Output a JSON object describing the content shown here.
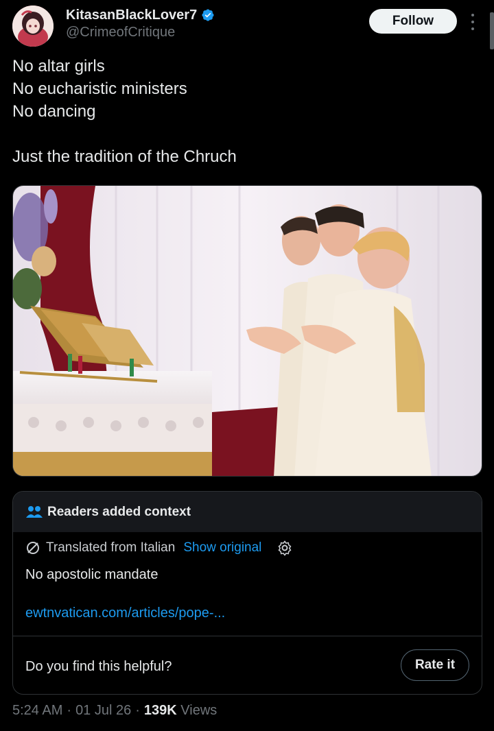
{
  "author": {
    "display_name": "KitasanBlackLover7",
    "handle": "@CrimeofCritique",
    "verified": true
  },
  "actions": {
    "follow_label": "Follow",
    "more_icon": "more-vertical-icon"
  },
  "tweet": {
    "lines": [
      "No altar girls",
      "No eucharistic ministers",
      "No dancing",
      "",
      "Just the tradition of the Chruch"
    ]
  },
  "community_note": {
    "title": "Readers added context",
    "translated_label": "Translated from Italian",
    "show_original_label": "Show original",
    "body": "No apostolic mandate",
    "link": "ewtnvatican.com/articles/pope-...",
    "helpful_question": "Do you find this helpful?",
    "rate_label": "Rate it"
  },
  "meta": {
    "time": "5:24 AM",
    "date": "01 Jul 26",
    "views_count": "139K",
    "views_label": "Views",
    "separator": "·"
  },
  "colors": {
    "background": "#000000",
    "accent": "#1d9bf0",
    "text": "#e7e9ea",
    "muted": "#71767b"
  }
}
